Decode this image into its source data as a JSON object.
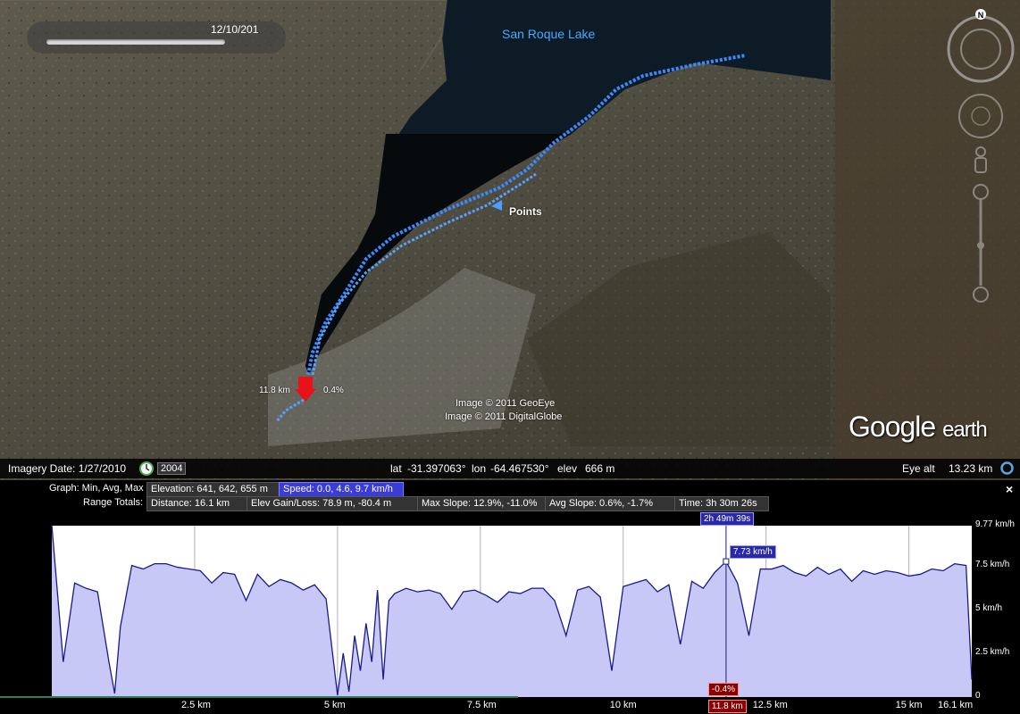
{
  "map": {
    "slider_date": "12/10/201",
    "lake_label": "San Roque Lake",
    "points_label": "Points",
    "copyright_1": "Image © 2011 GeoEye",
    "copyright_2": "Image © 2011 DigitalGlobe",
    "marker_distance": "11.8 km",
    "marker_slope": "0.4%",
    "logo_google": "Google",
    "logo_earth": "earth",
    "north": "N"
  },
  "status": {
    "imagery_date": "Imagery Date: 1/27/2010",
    "history_year": "2004",
    "lat_label": "lat",
    "lat": "-31.397063°",
    "lon_label": "lon",
    "lon": "-64.467530°",
    "elev_label": "elev",
    "elev": "666 m",
    "eye_alt_label": "Eye alt",
    "eye_alt": "13.23 km"
  },
  "panel": {
    "graph_label": "Graph: Min, Avg, Max",
    "elevation": "Elevation: 641, 642, 655 m",
    "speed": "Speed: 0.0, 4.6, 9.7 km/h",
    "range_label": "Range Totals:",
    "distance": "Distance: 16.1 km",
    "gain_loss": "Elev Gain/Loss: 78.9 m, -80.4 m",
    "max_slope": "Max Slope: 12.9%, -11.0%",
    "avg_slope": "Avg Slope: 0.6%, -1.7%",
    "time": "Time: 3h 30m 26s",
    "cursor_time": "2h 49m 39s",
    "cursor_speed": "7.73 km/h",
    "cursor_slope": "-0.4%",
    "cursor_distance": "11.8 km",
    "close": "×"
  },
  "chart_data": {
    "type": "area",
    "xlabel": "",
    "ylabel": "",
    "x_ticks": [
      "2.5 km",
      "5 km",
      "7.5 km",
      "10 km",
      "12.5 km",
      "15 km",
      "16.1 km"
    ],
    "y_ticks": [
      "9.77 km/h",
      "7.5 km/h",
      "5 km/h",
      "2.5 km/h",
      "0"
    ],
    "xlim": [
      0,
      16.1
    ],
    "ylim": [
      0,
      9.77
    ],
    "series": [
      {
        "name": "Speed",
        "x": [
          0.0,
          0.2,
          0.4,
          0.6,
          0.8,
          1.0,
          1.1,
          1.2,
          1.4,
          1.6,
          1.8,
          2.0,
          2.2,
          2.4,
          2.6,
          2.8,
          3.0,
          3.2,
          3.4,
          3.6,
          3.8,
          4.0,
          4.2,
          4.4,
          4.6,
          4.8,
          5.0,
          5.1,
          5.2,
          5.3,
          5.4,
          5.5,
          5.6,
          5.7,
          5.8,
          5.9,
          6.0,
          6.2,
          6.4,
          6.6,
          6.8,
          7.0,
          7.2,
          7.4,
          7.6,
          7.8,
          8.0,
          8.2,
          8.4,
          8.6,
          8.8,
          9.0,
          9.2,
          9.4,
          9.6,
          9.8,
          10.0,
          10.2,
          10.4,
          10.6,
          10.8,
          11.0,
          11.2,
          11.4,
          11.6,
          11.8,
          12.0,
          12.2,
          12.4,
          12.6,
          12.8,
          13.0,
          13.2,
          13.4,
          13.6,
          13.8,
          14.0,
          14.2,
          14.4,
          14.6,
          14.8,
          15.0,
          15.2,
          15.4,
          15.6,
          15.8,
          16.0,
          16.1
        ],
        "values": [
          9.8,
          2.0,
          6.5,
          6.2,
          6.0,
          2.0,
          0.2,
          4.0,
          7.5,
          7.3,
          7.6,
          7.6,
          7.4,
          7.3,
          7.2,
          6.5,
          7.1,
          7.0,
          5.5,
          7.0,
          6.3,
          6.7,
          6.5,
          6.1,
          6.4,
          5.6,
          0.1,
          2.5,
          0.3,
          3.5,
          1.5,
          4.2,
          2.0,
          6.1,
          1.0,
          5.5,
          5.9,
          6.2,
          6.0,
          6.1,
          5.9,
          5.0,
          6.0,
          6.1,
          5.8,
          5.4,
          6.0,
          5.9,
          6.2,
          6.2,
          5.5,
          3.5,
          6.1,
          6.3,
          5.7,
          1.5,
          6.3,
          6.5,
          6.7,
          6.0,
          6.4,
          3.0,
          6.6,
          6.2,
          7.1,
          7.73,
          6.5,
          3.5,
          7.3,
          7.3,
          7.5,
          7.1,
          6.9,
          7.4,
          7.0,
          7.3,
          6.6,
          7.2,
          7.0,
          7.2,
          7.1,
          6.9,
          7.0,
          7.3,
          7.2,
          7.6,
          7.5,
          1.0
        ]
      }
    ],
    "cursor": {
      "x": 11.8,
      "value": 7.73
    },
    "grid": true,
    "fill_color": "#c8c8f6",
    "line_color": "#1a1a8c"
  }
}
